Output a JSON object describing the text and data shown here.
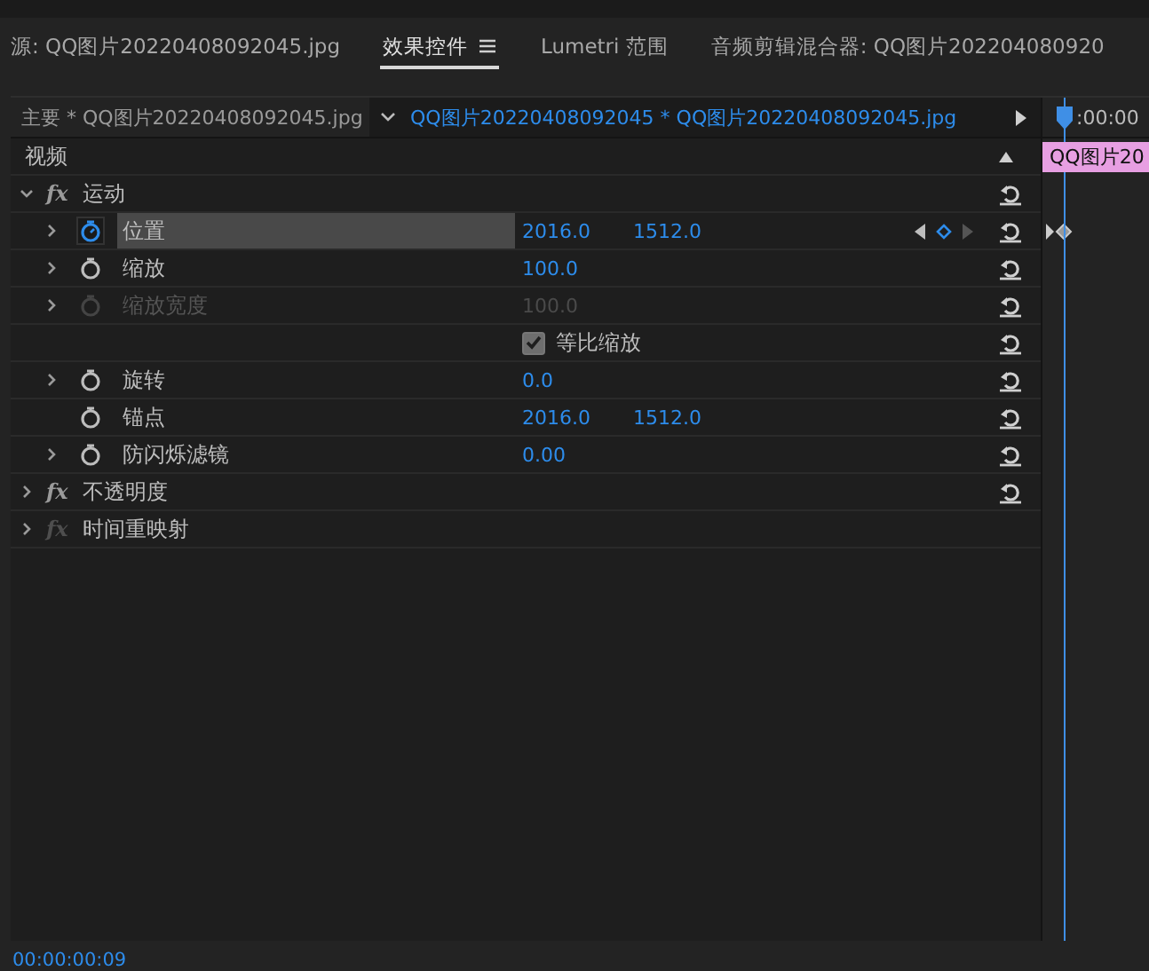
{
  "panel_tabs": [
    {
      "label": "源: QQ图片20220408092045.jpg",
      "selected": false,
      "menu": false
    },
    {
      "label": "效果控件",
      "selected": true,
      "menu": true
    },
    {
      "label": "Lumetri 范围",
      "selected": false,
      "menu": false
    },
    {
      "label": "音频剪辑混合器: QQ图片202204080920",
      "selected": false,
      "menu": false
    }
  ],
  "header": {
    "master_clip": "主要 * QQ图片20220408092045.jpg",
    "sequence_clip": "QQ图片20220408092045  * QQ图片20220408092045.jpg",
    "ruler_time": ":00:00"
  },
  "timeline": {
    "clip_label": "QQ图片20"
  },
  "rows": [
    {
      "kind": "section",
      "label": "视频"
    },
    {
      "kind": "effect",
      "fx": "fx",
      "label": "运动",
      "expanded": true,
      "fx_enabled": true,
      "reset": true
    },
    {
      "kind": "property",
      "label": "位置",
      "expander": true,
      "animating": true,
      "selected": true,
      "disabled": false,
      "values": [
        "2016.0",
        "1512.0"
      ],
      "keyframe_nav": true,
      "keyframe": true
    },
    {
      "kind": "property",
      "label": "缩放",
      "expander": true,
      "animating": false,
      "selected": false,
      "disabled": false,
      "values": [
        "100.0"
      ],
      "keyframe_nav": false,
      "keyframe": false
    },
    {
      "kind": "property",
      "label": "缩放宽度",
      "expander": true,
      "animating": false,
      "selected": false,
      "disabled": true,
      "values": [
        "100.0"
      ],
      "keyframe_nav": false,
      "keyframe": false
    },
    {
      "kind": "checkbox",
      "label": "等比缩放",
      "checked": true
    },
    {
      "kind": "property",
      "label": "旋转",
      "expander": true,
      "animating": false,
      "selected": false,
      "disabled": false,
      "values": [
        "0.0"
      ],
      "keyframe_nav": false,
      "keyframe": false
    },
    {
      "kind": "property",
      "label": "锚点",
      "expander": false,
      "animating": false,
      "selected": false,
      "disabled": false,
      "values": [
        "2016.0",
        "1512.0"
      ],
      "keyframe_nav": false,
      "keyframe": false
    },
    {
      "kind": "property",
      "label": "防闪烁滤镜",
      "expander": true,
      "animating": false,
      "selected": false,
      "disabled": false,
      "values": [
        "0.00"
      ],
      "keyframe_nav": false,
      "keyframe": false
    },
    {
      "kind": "effect",
      "fx": "fx",
      "label": "不透明度",
      "expanded": false,
      "fx_enabled": true,
      "reset": true
    },
    {
      "kind": "effect",
      "fx": "fx",
      "label": "时间重映射",
      "expanded": false,
      "fx_enabled": false,
      "reset": false
    }
  ],
  "status": {
    "timecode": "00:00:00:09"
  }
}
